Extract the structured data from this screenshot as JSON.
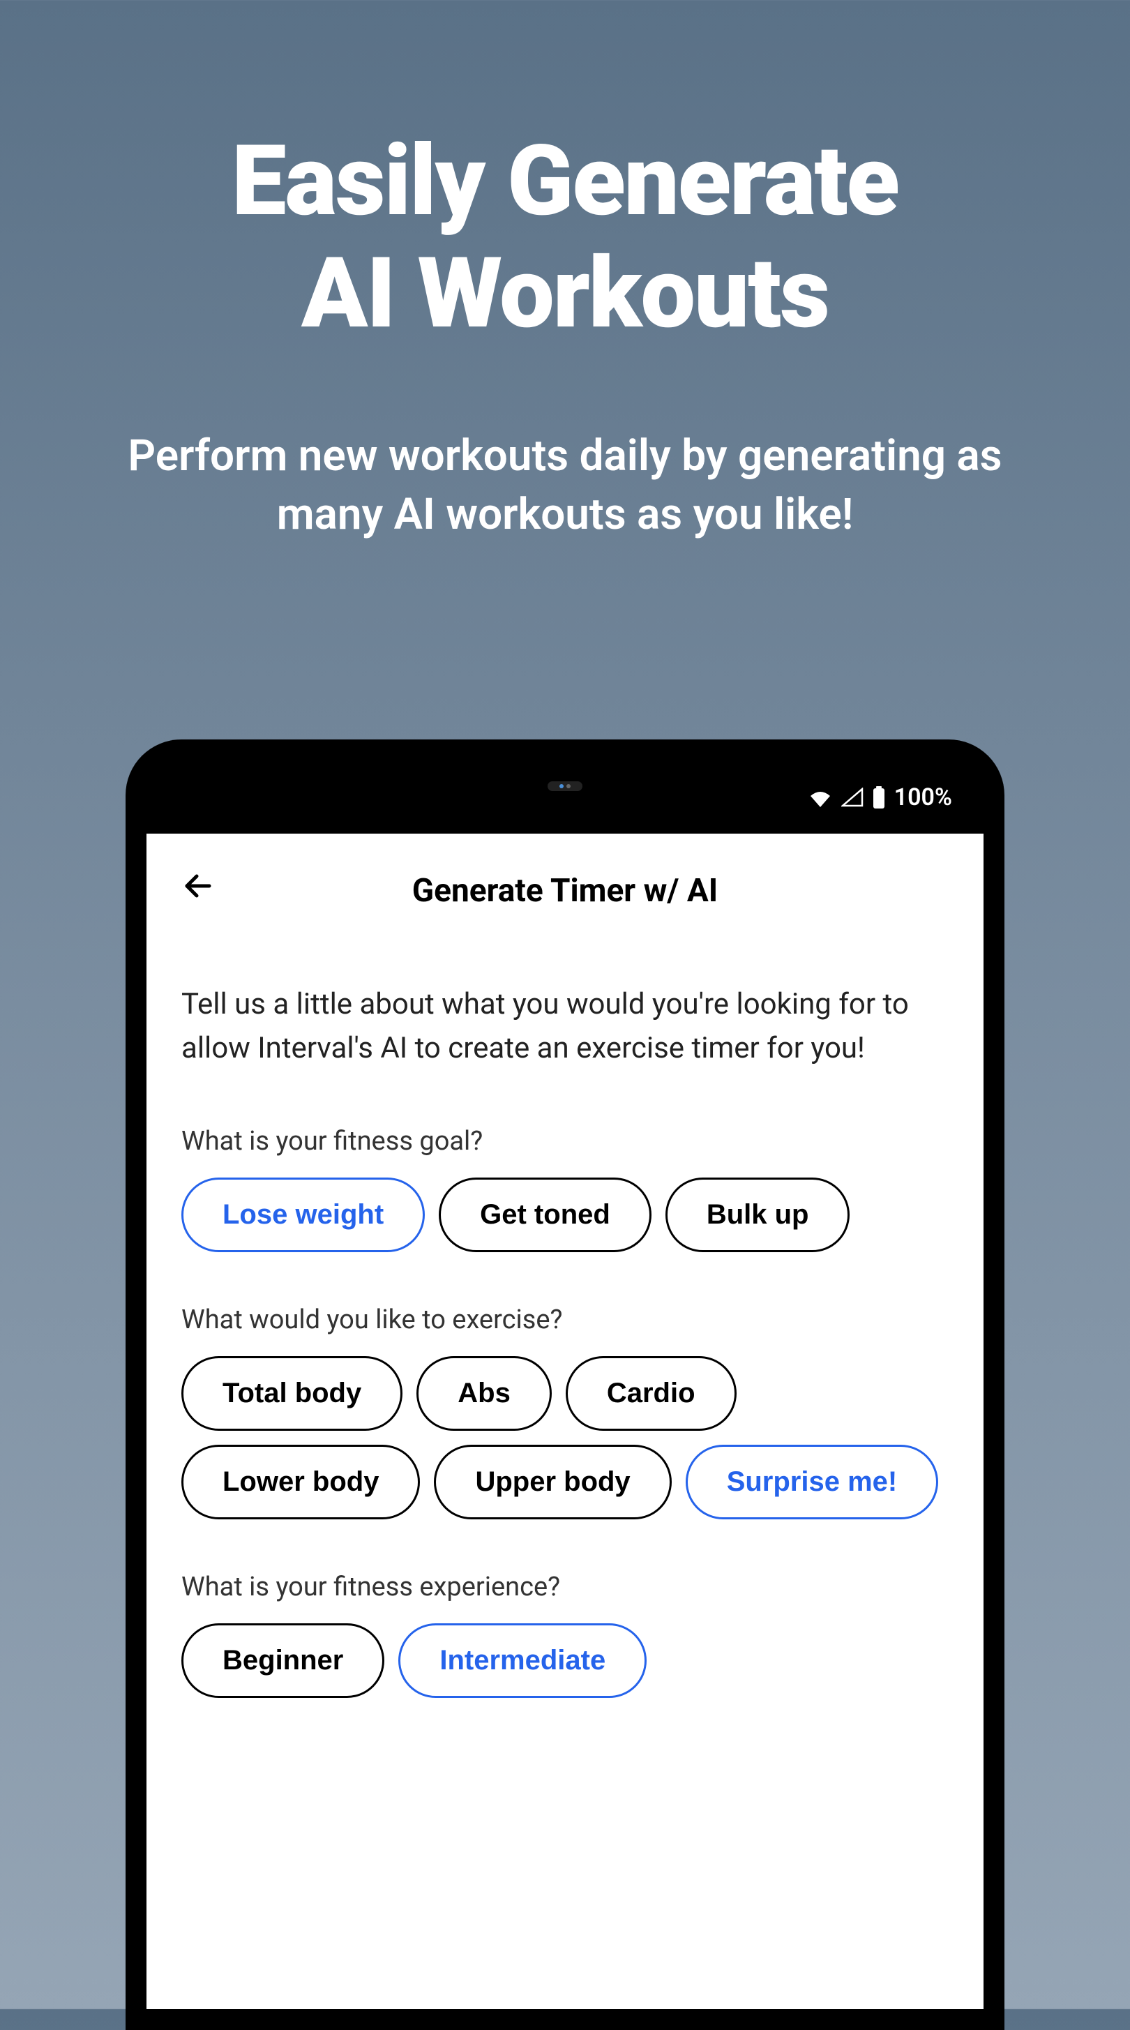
{
  "promo": {
    "headline_line1": "Easily Generate",
    "headline_line2": "AI Workouts",
    "subtitle": "Perform new workouts daily by generating as many AI workouts as you like!"
  },
  "status_bar": {
    "battery_percent": "100%"
  },
  "app": {
    "title": "Generate Timer w/ AI",
    "intro": "Tell us a little about what you would you're looking for to allow Interval's AI to create an exercise timer for you!",
    "sections": [
      {
        "question": "What is your fitness goal?",
        "options": [
          {
            "label": "Lose weight",
            "selected": true
          },
          {
            "label": "Get toned",
            "selected": false
          },
          {
            "label": "Bulk up",
            "selected": false
          }
        ]
      },
      {
        "question": "What would you like to exercise?",
        "options": [
          {
            "label": "Total body",
            "selected": false
          },
          {
            "label": "Abs",
            "selected": false
          },
          {
            "label": "Cardio",
            "selected": false
          },
          {
            "label": "Lower body",
            "selected": false
          },
          {
            "label": "Upper body",
            "selected": false
          },
          {
            "label": "Surprise me!",
            "selected": true
          }
        ]
      },
      {
        "question": "What is your fitness experience?",
        "options": [
          {
            "label": "Beginner",
            "selected": false
          },
          {
            "label": "Intermediate",
            "selected": true
          }
        ]
      }
    ]
  }
}
